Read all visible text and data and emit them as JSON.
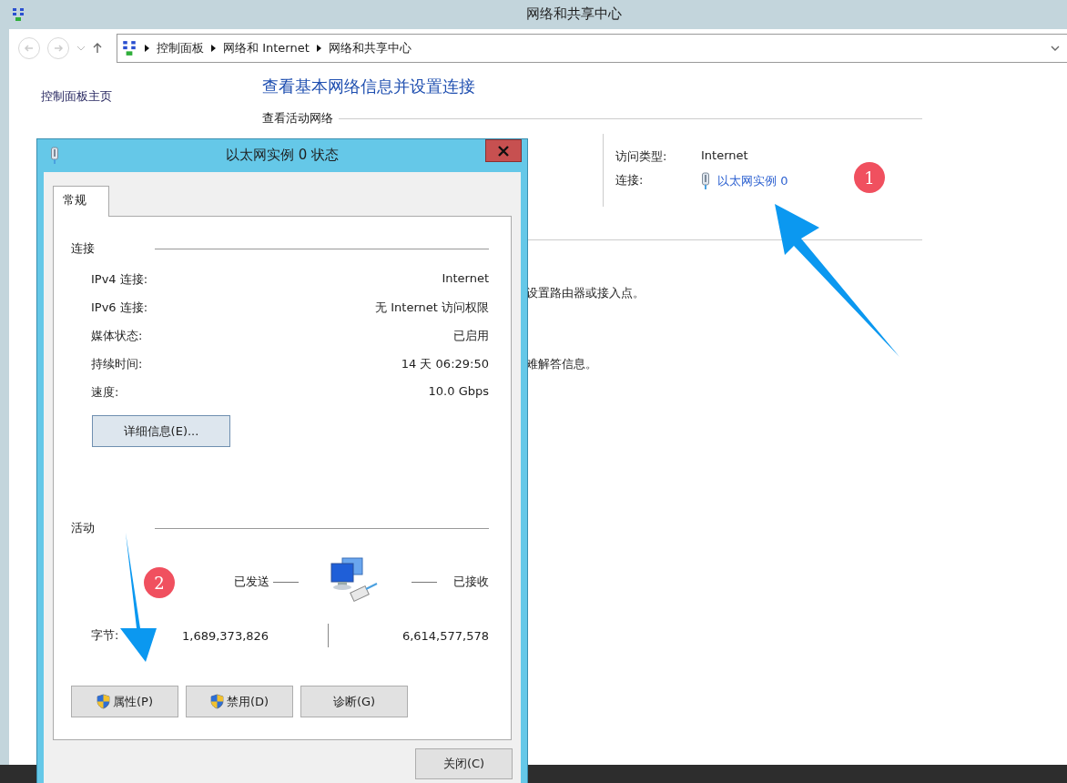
{
  "window": {
    "title": "网络和共享中心"
  },
  "breadcrumb": [
    "控制面板",
    "网络和 Internet",
    "网络和共享中心"
  ],
  "sidebar": {
    "items": [
      "控制面板主页"
    ]
  },
  "main": {
    "heading": "查看基本网络信息并设置连接",
    "active_networks_label": "查看活动网络",
    "access_type_label": "访问类型:",
    "access_type": "Internet",
    "connection_label": "连接:",
    "connection_link": "以太网实例 0",
    "fragments": [
      "设置路由器或接入点。",
      "难解答信息。"
    ]
  },
  "dialog": {
    "title": "以太网实例 0 状态",
    "tabs": [
      {
        "label": "常规",
        "selected": true
      }
    ],
    "connection": {
      "title": "连接",
      "rows": [
        {
          "label": "IPv4 连接:",
          "value": "Internet"
        },
        {
          "label": "IPv6 连接:",
          "value": "无 Internet 访问权限"
        },
        {
          "label": "媒体状态:",
          "value": "已启用"
        },
        {
          "label": "持续时间:",
          "value": "14 天 06:29:50"
        },
        {
          "label": "速度:",
          "value": "10.0 Gbps"
        }
      ]
    },
    "details_button": "详细信息(E)...",
    "activity": {
      "title": "活动",
      "sent_label": "已发送",
      "received_label": "已接收",
      "bytes_label": "字节:",
      "sent": "1,689,373,826",
      "received": "6,614,577,578"
    },
    "buttons": [
      {
        "label": "属性(P)",
        "shield": true
      },
      {
        "label": "禁用(D)",
        "shield": true
      },
      {
        "label": "诊断(G)",
        "shield": false
      }
    ],
    "close_button": "关闭(C)"
  },
  "annotations": [
    {
      "number": "1"
    },
    {
      "number": "2"
    }
  ]
}
